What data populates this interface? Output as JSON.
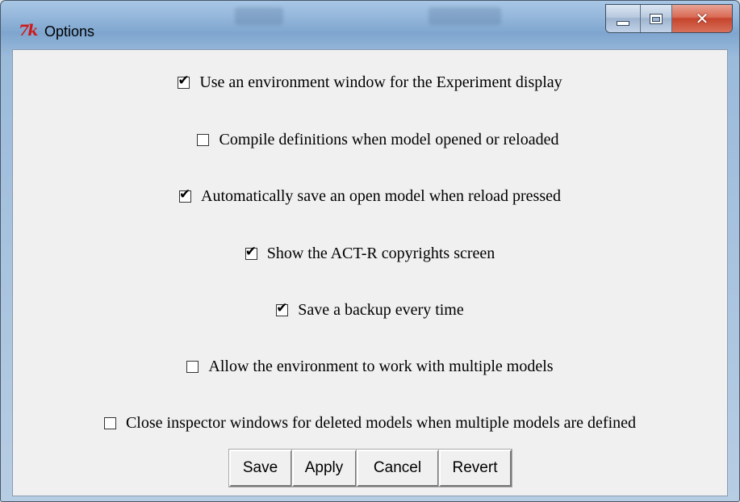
{
  "window": {
    "title": "Options",
    "icon": "tk-feather-icon"
  },
  "options": [
    {
      "label": "Use an environment window for the Experiment display",
      "checked": true
    },
    {
      "label": "Compile definitions when model opened or reloaded",
      "checked": false
    },
    {
      "label": "Automatically save an open model when reload pressed",
      "checked": true
    },
    {
      "label": "Show the ACT-R copyrights screen",
      "checked": true
    },
    {
      "label": "Save a backup every time",
      "checked": true
    },
    {
      "label": "Allow the environment to work with multiple models",
      "checked": false
    },
    {
      "label": "Close inspector windows for deleted models when multiple models are defined",
      "checked": false
    }
  ],
  "buttons": {
    "save": "Save",
    "apply": "Apply",
    "cancel": "Cancel",
    "revert": "Revert"
  },
  "colors": {
    "close_button": "#c7442c",
    "client_bg": "#f0f0f0"
  }
}
